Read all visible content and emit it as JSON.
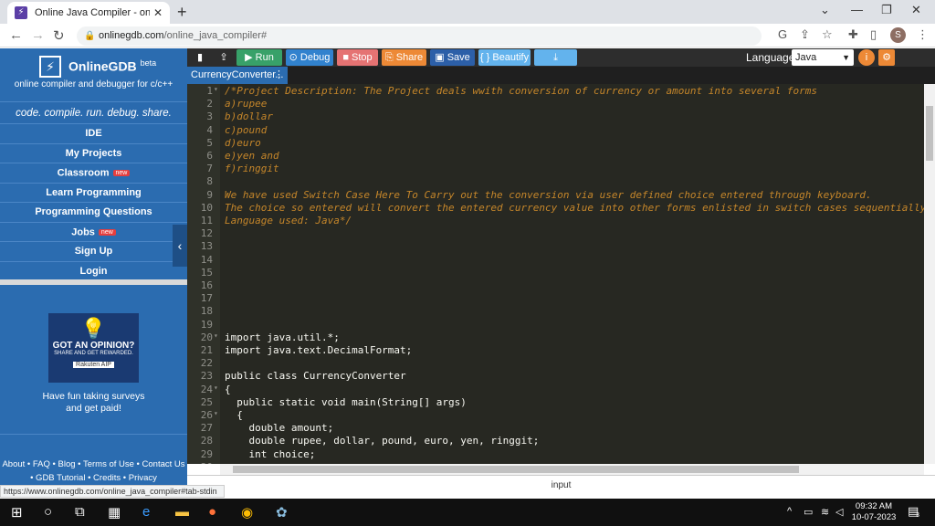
{
  "browser": {
    "tab_title": "Online Java Compiler - online ed",
    "url_host": "onlinegdb.com",
    "url_path": "/online_java_compiler#",
    "profile_initial": "S",
    "status_url": "https://www.onlinegdb.com/online_java_compiler#tab-stdin"
  },
  "sidebar": {
    "brand_name": "OnlineGDB",
    "brand_sup": "beta",
    "tagline": "online compiler and debugger for c/c++",
    "motto": "code. compile. run. debug. share.",
    "items": [
      {
        "label": "IDE",
        "badge": ""
      },
      {
        "label": "My Projects",
        "badge": ""
      },
      {
        "label": "Classroom",
        "badge": "new"
      },
      {
        "label": "Learn Programming",
        "badge": ""
      },
      {
        "label": "Programming Questions",
        "badge": ""
      },
      {
        "label": "Jobs",
        "badge": "new"
      },
      {
        "label": "Sign Up",
        "badge": ""
      },
      {
        "label": "Login",
        "badge": ""
      }
    ],
    "ad": {
      "line1": "GOT AN OPINION?",
      "line2": "SHARE AND GET REWARDED.",
      "line3": "Rakuten AIP",
      "caption1": "Have fun taking surveys",
      "caption2": "and get paid!"
    },
    "footer_line1": "About • FAQ • Blog • Terms of Use • Contact Us",
    "footer_line2": "• GDB Tutorial • Credits • Privacy"
  },
  "toolbar": {
    "run": "Run",
    "debug": "Debug",
    "stop": "Stop",
    "share": "Share",
    "save": "Save",
    "beautify": "{ } Beautify",
    "language_label": "Language",
    "language_value": "Java"
  },
  "file_tab": "CurrencyConverter...",
  "input_label": "input",
  "code_lines": [
    {
      "n": "1",
      "fold": true,
      "t": "/*Project Description: The Project deals wwith conversion of currency or amount into several forms",
      "c": "cm"
    },
    {
      "n": "2",
      "fold": false,
      "t": "a)rupee",
      "c": "cm"
    },
    {
      "n": "3",
      "fold": false,
      "t": "b)dollar",
      "c": "cm"
    },
    {
      "n": "4",
      "fold": false,
      "t": "c)pound",
      "c": "cm"
    },
    {
      "n": "5",
      "fold": false,
      "t": "d)euro",
      "c": "cm"
    },
    {
      "n": "6",
      "fold": false,
      "t": "e)yen and",
      "c": "cm"
    },
    {
      "n": "7",
      "fold": false,
      "t": "f)ringgit",
      "c": "cm"
    },
    {
      "n": "8",
      "fold": false,
      "t": "",
      "c": "cm"
    },
    {
      "n": "9",
      "fold": false,
      "t": "We have used Switch Case Here To Carry out the conversion via user defined choice entered through keyboard.",
      "c": "cm"
    },
    {
      "n": "10",
      "fold": false,
      "t": "The choice so entered will convert the entered currency value into other forms enlisted in switch cases sequentially",
      "c": "cm"
    },
    {
      "n": "11",
      "fold": false,
      "t": "Language used: Java*/",
      "c": "cm"
    },
    {
      "n": "12",
      "fold": false,
      "t": "",
      "c": "pl"
    },
    {
      "n": "13",
      "fold": false,
      "t": "",
      "c": "pl"
    },
    {
      "n": "14",
      "fold": false,
      "t": "",
      "c": "pl"
    },
    {
      "n": "15",
      "fold": false,
      "t": "",
      "c": "pl"
    },
    {
      "n": "16",
      "fold": false,
      "t": "",
      "c": "pl"
    },
    {
      "n": "17",
      "fold": false,
      "t": "",
      "c": "pl"
    },
    {
      "n": "18",
      "fold": false,
      "t": "",
      "c": "pl"
    },
    {
      "n": "19",
      "fold": false,
      "t": "",
      "c": "pl"
    },
    {
      "n": "20",
      "fold": true,
      "t": "import java.util.*;",
      "c": "pl"
    },
    {
      "n": "21",
      "fold": false,
      "t": "import java.text.DecimalFormat;",
      "c": "pl"
    },
    {
      "n": "22",
      "fold": false,
      "t": "",
      "c": "pl"
    },
    {
      "n": "23",
      "fold": false,
      "t": "public class CurrencyConverter",
      "c": "pl"
    },
    {
      "n": "24",
      "fold": true,
      "t": "{",
      "c": "pl"
    },
    {
      "n": "25",
      "fold": false,
      "t": "  public static void main(String[] args)",
      "c": "pl"
    },
    {
      "n": "26",
      "fold": true,
      "t": "  {",
      "c": "pl"
    },
    {
      "n": "27",
      "fold": false,
      "t": "    double amount;",
      "c": "pl"
    },
    {
      "n": "28",
      "fold": false,
      "t": "    double rupee, dollar, pound, euro, yen, ringgit;",
      "c": "pl"
    },
    {
      "n": "29",
      "fold": false,
      "t": "    int choice;",
      "c": "pl"
    },
    {
      "n": "30",
      "fold": false,
      "t": "",
      "c": "pl"
    }
  ],
  "taskbar": {
    "time": "09:32 AM",
    "date": "10-07-2023",
    "notif_count": "3"
  },
  "colors": {
    "sidebar_blue": "#2b6cb0",
    "run_green": "#38a169",
    "debug_blue": "#3182ce",
    "stop_red": "#e57373",
    "share_orange": "#ed8936",
    "save_blue": "#2c5fa8",
    "beautify_blue": "#63b3ed",
    "editor_bg": "#272822"
  }
}
